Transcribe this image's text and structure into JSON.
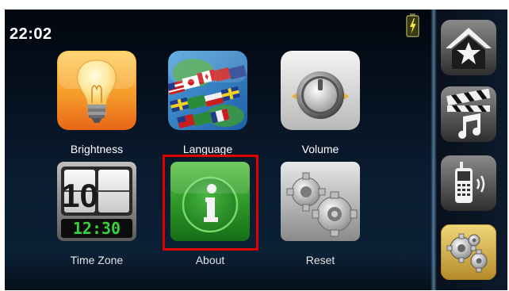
{
  "status_bar": {
    "time": "22:02",
    "battery_icon": "battery-charging-icon"
  },
  "settings_grid": {
    "items": [
      {
        "label": "Brightness",
        "icon": "lightbulb-icon"
      },
      {
        "label": "Language",
        "icon": "flags-globe-icon"
      },
      {
        "label": "Volume",
        "icon": "volume-knob-icon"
      },
      {
        "label": "Time Zone",
        "icon": "flip-clock-icon",
        "clock_top": "10",
        "clock_bottom": "12:30"
      },
      {
        "label": "About",
        "icon": "info-icon",
        "selected": true
      },
      {
        "label": "Reset",
        "icon": "gears-reset-icon"
      }
    ]
  },
  "side_menu": {
    "items": [
      {
        "icon": "home-star-icon"
      },
      {
        "icon": "media-clapper-music-icon"
      },
      {
        "icon": "phone-icon"
      },
      {
        "icon": "settings-gears-icon",
        "active": true
      }
    ]
  },
  "colors": {
    "highlight": "#e00000",
    "active_side": "#d8b650"
  }
}
